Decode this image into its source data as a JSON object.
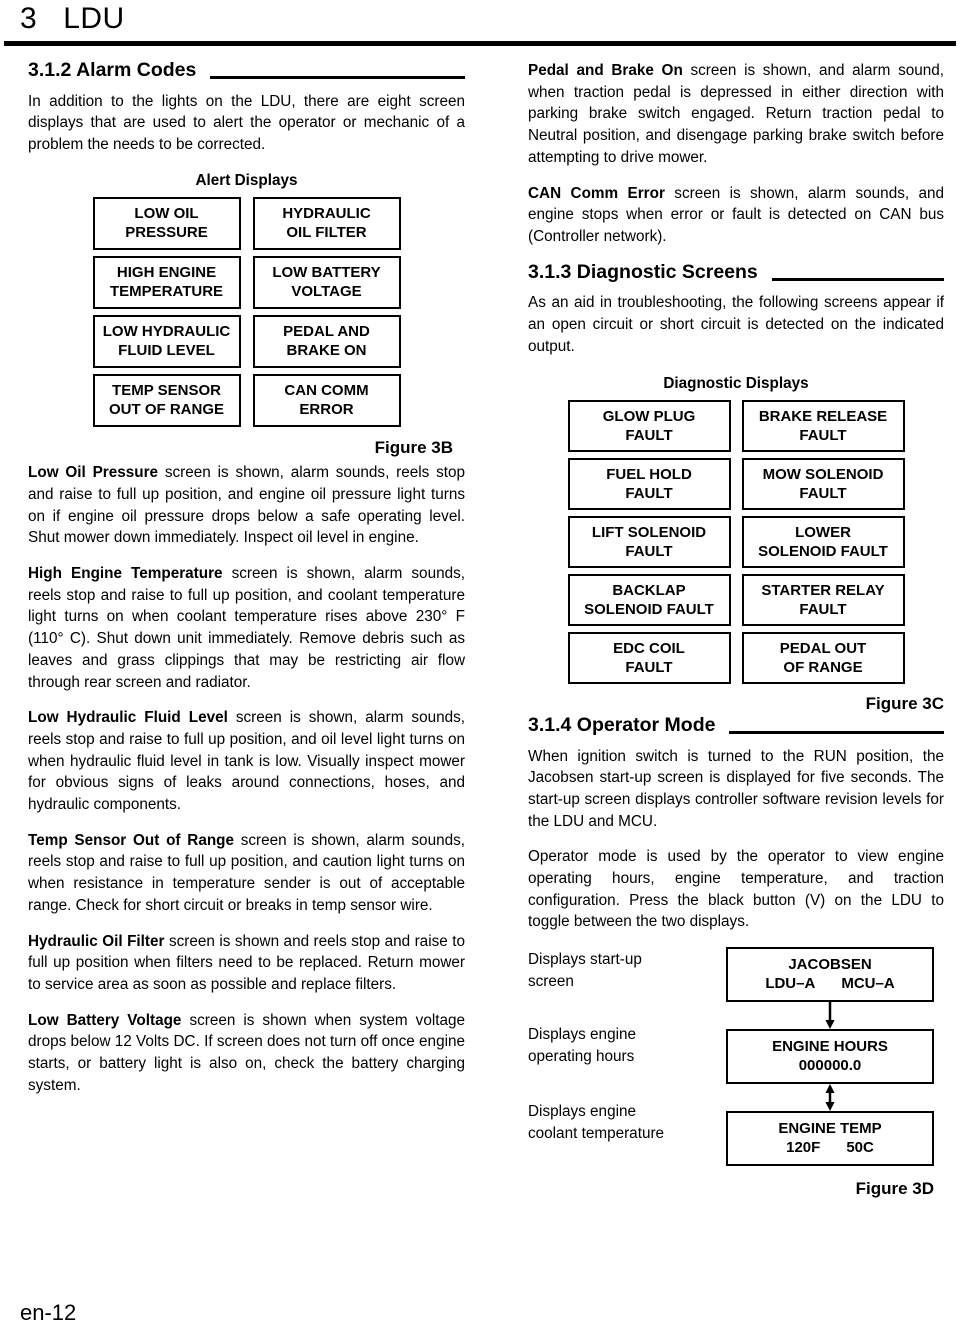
{
  "header": {
    "chapter_number": "3",
    "chapter_title": "LDU"
  },
  "footer": {
    "page_label": "en-12"
  },
  "left_column": {
    "section": {
      "number_title": "3.1.2 Alarm Codes"
    },
    "intro": "In addition to the lights on the LDU, there are eight screen displays that are used to alert the operator or mechanic of a problem the needs to be corrected.",
    "alert_figure": {
      "title": "Alert Displays",
      "caption": "Figure 3B",
      "column_1": [
        "LOW OIL\nPRESSURE",
        "HIGH ENGINE\nTEMPERATURE",
        "LOW HYDRAULIC\nFLUID LEVEL",
        "TEMP SENSOR\nOUT OF RANGE"
      ],
      "column_2": [
        "HYDRAULIC\nOIL FILTER",
        "LOW BATTERY\nVOLTAGE",
        "PEDAL AND\nBRAKE ON",
        "CAN COMM\nERROR"
      ]
    },
    "paragraphs": [
      {
        "lead": "Low Oil Pressure",
        "text": " screen is shown, alarm sounds, reels stop and raise to full up position, and engine oil pressure light turns on if engine oil pressure drops below a safe operating level. Shut mower down immediately. Inspect oil level in engine."
      },
      {
        "lead": "High Engine Temperature",
        "text": " screen is shown, alarm sounds, reels stop and raise to full up position, and coolant temperature light turns on when coolant temperature rises above 230° F (110° C). Shut down unit immediately. Remove debris such as leaves and grass clippings that may be restricting air flow through rear screen and radiator."
      },
      {
        "lead": "Low Hydraulic Fluid Level",
        "text": " screen is shown, alarm sounds, reels stop and raise to full up position, and oil level light turns on when hydraulic fluid level in tank is low. Visually inspect mower for obvious signs of leaks around connections, hoses, and hydraulic components."
      },
      {
        "lead": "Temp Sensor Out of Range",
        "text": " screen is shown, alarm sounds, reels stop and raise to full up position, and caution light turns on when resistance in temperature sender is out of acceptable range. Check for short circuit or breaks in temp sensor wire."
      },
      {
        "lead": "Hydraulic Oil Filter",
        "text": " screen is shown and reels stop and raise to full up position  when filters need to be replaced. Return mower to service area as soon as possible and replace filters."
      },
      {
        "lead": "Low Battery Voltage",
        "text": " screen is shown when system voltage drops below 12 Volts DC. If screen does not turn off once engine starts, or battery light is also on, check the battery charging system."
      }
    ]
  },
  "right_column": {
    "paragraphs_top": [
      {
        "lead": "Pedal and Brake On",
        "text": " screen is shown, and alarm sound, when traction pedal is depressed in either direction with parking brake switch engaged. Return traction pedal to Neutral position, and disengage parking brake switch before attempting to drive mower."
      },
      {
        "lead": "CAN Comm Error",
        "text": " screen is shown, alarm sounds, and engine stops when error or fault is detected on CAN bus  (Controller network)."
      }
    ],
    "section_diagnostic": {
      "number_title": "3.1.3 Diagnostic Screens",
      "intro": "As an aid in troubleshooting, the following screens appear if an open circuit or short circuit is detected on the indicated output."
    },
    "diagnostic_figure": {
      "title": "Diagnostic Displays",
      "caption": "Figure 3C",
      "column_1": [
        "GLOW PLUG\nFAULT",
        "FUEL HOLD\nFAULT",
        "LIFT SOLENOID\nFAULT",
        "BACKLAP\nSOLENOID FAULT",
        "EDC COIL\nFAULT"
      ],
      "column_2": [
        "BRAKE RELEASE\nFAULT",
        "MOW SOLENOID\nFAULT",
        "LOWER\nSOLENOID FAULT",
        "STARTER RELAY\nFAULT",
        "PEDAL OUT\nOF RANGE"
      ]
    },
    "section_operator": {
      "number_title": "3.1.4 Operator Mode",
      "paragraphs": [
        "When ignition switch is turned to the RUN position, the Jacobsen start-up screen is displayed for five seconds. The start-up screen displays controller software revision levels for the LDU and MCU.",
        "Operator mode is used by the operator to view engine operating hours, engine temperature, and traction configuration. Press the black button (V) on the LDU to toggle between the two displays."
      ]
    },
    "flow_figure": {
      "caption": "Figure 3D",
      "rows": [
        {
          "label": "Displays start-up\nscreen",
          "screen_line1": "JACOBSEN",
          "screen_line2_left": "LDU–A",
          "screen_line2_right": "MCU–A",
          "arrow_below": "down"
        },
        {
          "label": "Displays engine\noperating hours",
          "screen_line1": "ENGINE HOURS",
          "screen_line2_left": "000000.0",
          "screen_line2_right": "",
          "arrow_below": "up-down"
        },
        {
          "label": "Displays engine\ncoolant temperature",
          "screen_line1": "ENGINE TEMP",
          "screen_line2_left": "120F",
          "screen_line2_right": "50C",
          "arrow_below": ""
        }
      ]
    }
  }
}
